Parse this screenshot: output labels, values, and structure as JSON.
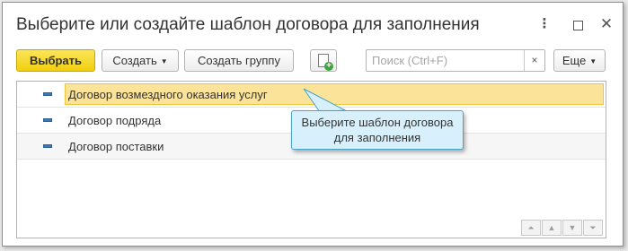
{
  "window": {
    "title": "Выберите или создайте шаблон договора для заполнения",
    "controls": {
      "more": "⋮",
      "maximize": "",
      "close": "✕"
    }
  },
  "toolbar": {
    "select_label": "Выбрать",
    "create_label": "Создать",
    "create_group_label": "Создать группу",
    "copy_icon": "add-document-icon",
    "search": {
      "placeholder": "Поиск (Ctrl+F)",
      "value": "",
      "clear": "×"
    },
    "more_label": "Еще"
  },
  "list": {
    "rows": [
      {
        "label": "Договор возмездного оказания услуг",
        "selected": true
      },
      {
        "label": "Договор подряда",
        "selected": false
      },
      {
        "label": "Договор поставки",
        "selected": false
      }
    ]
  },
  "tooltip": {
    "line1": "Выберите шаблон договора",
    "line2": "для заполнения"
  },
  "navigation": {
    "first": "⏶",
    "prev": "▲",
    "next": "▼",
    "last": "⏷"
  },
  "colors": {
    "primary_button": "#f1cf0d",
    "selection": "#fbe49a",
    "tooltip_bg": "#d7f0fb",
    "tooltip_border": "#4aa3c9",
    "row_marker": "#3d79b8"
  }
}
